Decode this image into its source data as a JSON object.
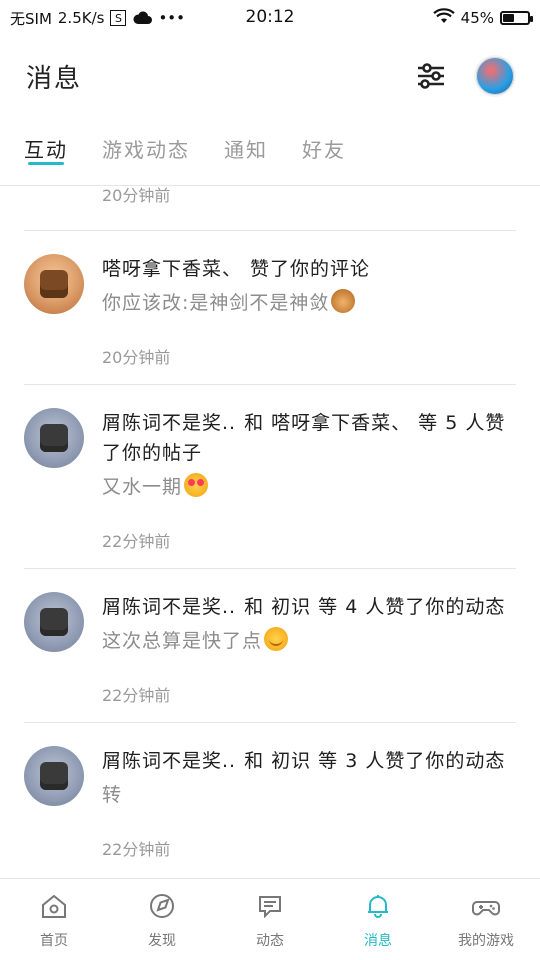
{
  "status_bar": {
    "carrier": "无SIM",
    "speed": "2.5K/s",
    "sim_icon_letter": "S",
    "more": "•••",
    "time": "20:12",
    "battery": "45%"
  },
  "header": {
    "title": "消息",
    "icons": [
      "sliders-icon",
      "profile-avatar"
    ]
  },
  "tabs": [
    {
      "label": "互动",
      "active": true
    },
    {
      "label": "游戏动态",
      "active": false
    },
    {
      "label": "通知",
      "active": false
    },
    {
      "label": "好友",
      "active": false
    }
  ],
  "content": {
    "partial_time": "20分钟前",
    "items": [
      {
        "name": "嗒呀拿下香菜、",
        "action": "赞了你的评论",
        "sub": "你应该改:是神剑不是神敛",
        "time": "20分钟前",
        "avatar": "avatar-girl",
        "emoji": "monkey-emoji"
      },
      {
        "name": "屑陈词不是奖..",
        "action": "和 嗒呀拿下香菜、 等 5 人赞",
        "action_line2": "了你的帖子",
        "sub": "又水一期",
        "time": "22分钟前",
        "avatar": "avatar-boy",
        "emoji": "heart-eyes-emoji"
      },
      {
        "name": "屑陈词不是奖..",
        "action": "和 初识 等 4 人赞了你的动态",
        "sub": "这次总算是快了点",
        "time": "22分钟前",
        "avatar": "avatar-boy",
        "emoji": "smile-emoji"
      },
      {
        "name": "屑陈词不是奖..",
        "action": "和 初识 等 3 人赞了你的动态",
        "sub": "转",
        "time": "22分钟前",
        "avatar": "avatar-boy",
        "emoji": ""
      }
    ]
  },
  "bottom_nav": [
    {
      "label": "首页",
      "icon": "home-icon",
      "active": false
    },
    {
      "label": "发现",
      "icon": "discover-icon",
      "active": false
    },
    {
      "label": "动态",
      "icon": "feed-icon",
      "active": false
    },
    {
      "label": "消息",
      "icon": "bell-icon",
      "active": true
    },
    {
      "label": "我的游戏",
      "icon": "gamepad-icon",
      "active": false
    }
  ],
  "colors": {
    "accent": "#25b8c6",
    "text": "#1f1f1f",
    "muted": "#9a9a9a"
  }
}
